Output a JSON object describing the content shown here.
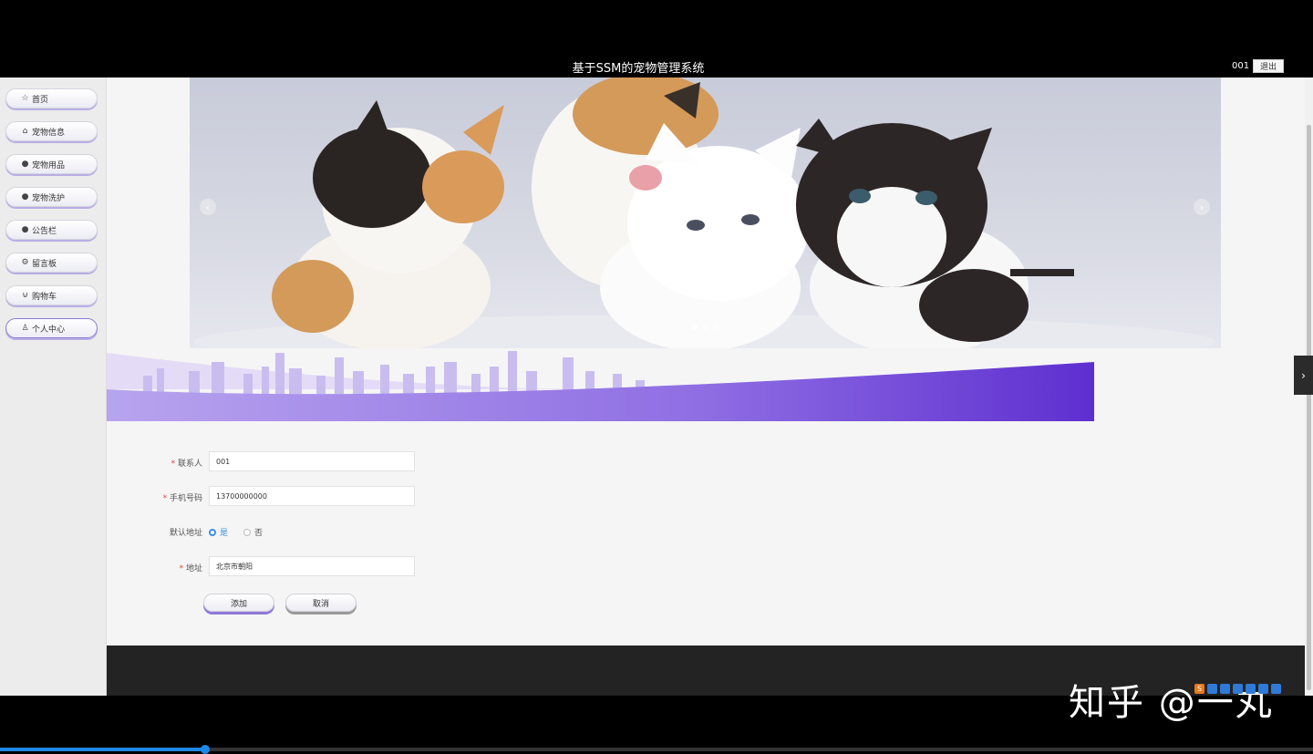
{
  "header": {
    "title": "基于SSM的宠物管理系统",
    "username": "001",
    "logout_label": "退出"
  },
  "sidebar": {
    "items": [
      {
        "label": "首页",
        "icon": "star-icon"
      },
      {
        "label": "宠物信息",
        "icon": "bag-icon"
      },
      {
        "label": "宠物用品",
        "icon": "circle-icon"
      },
      {
        "label": "宠物洗护",
        "icon": "question-circle-icon"
      },
      {
        "label": "公告栏",
        "icon": "info-circle-icon"
      },
      {
        "label": "留言板",
        "icon": "gear-icon"
      },
      {
        "label": "购物车",
        "icon": "cart-icon"
      },
      {
        "label": "个人中心",
        "icon": "user-icon"
      }
    ]
  },
  "carousel": {
    "slide_count": 3,
    "active_index": 0
  },
  "form": {
    "contact_label": "联系人",
    "contact_value": "001",
    "phone_label": "手机号码",
    "phone_value": "13700000000",
    "default_label": "默认地址",
    "default_yes": "是",
    "default_no": "否",
    "address_label": "地址",
    "address_value": "北京市朝阳",
    "submit_label": "添加",
    "cancel_label": "取消"
  },
  "watermark": {
    "text": "知乎 @一丸"
  },
  "colors": {
    "accent": "#6a3fd6",
    "radio_selected": "#3a8ee6",
    "footer": "#232323"
  },
  "video_progress": 0.158
}
